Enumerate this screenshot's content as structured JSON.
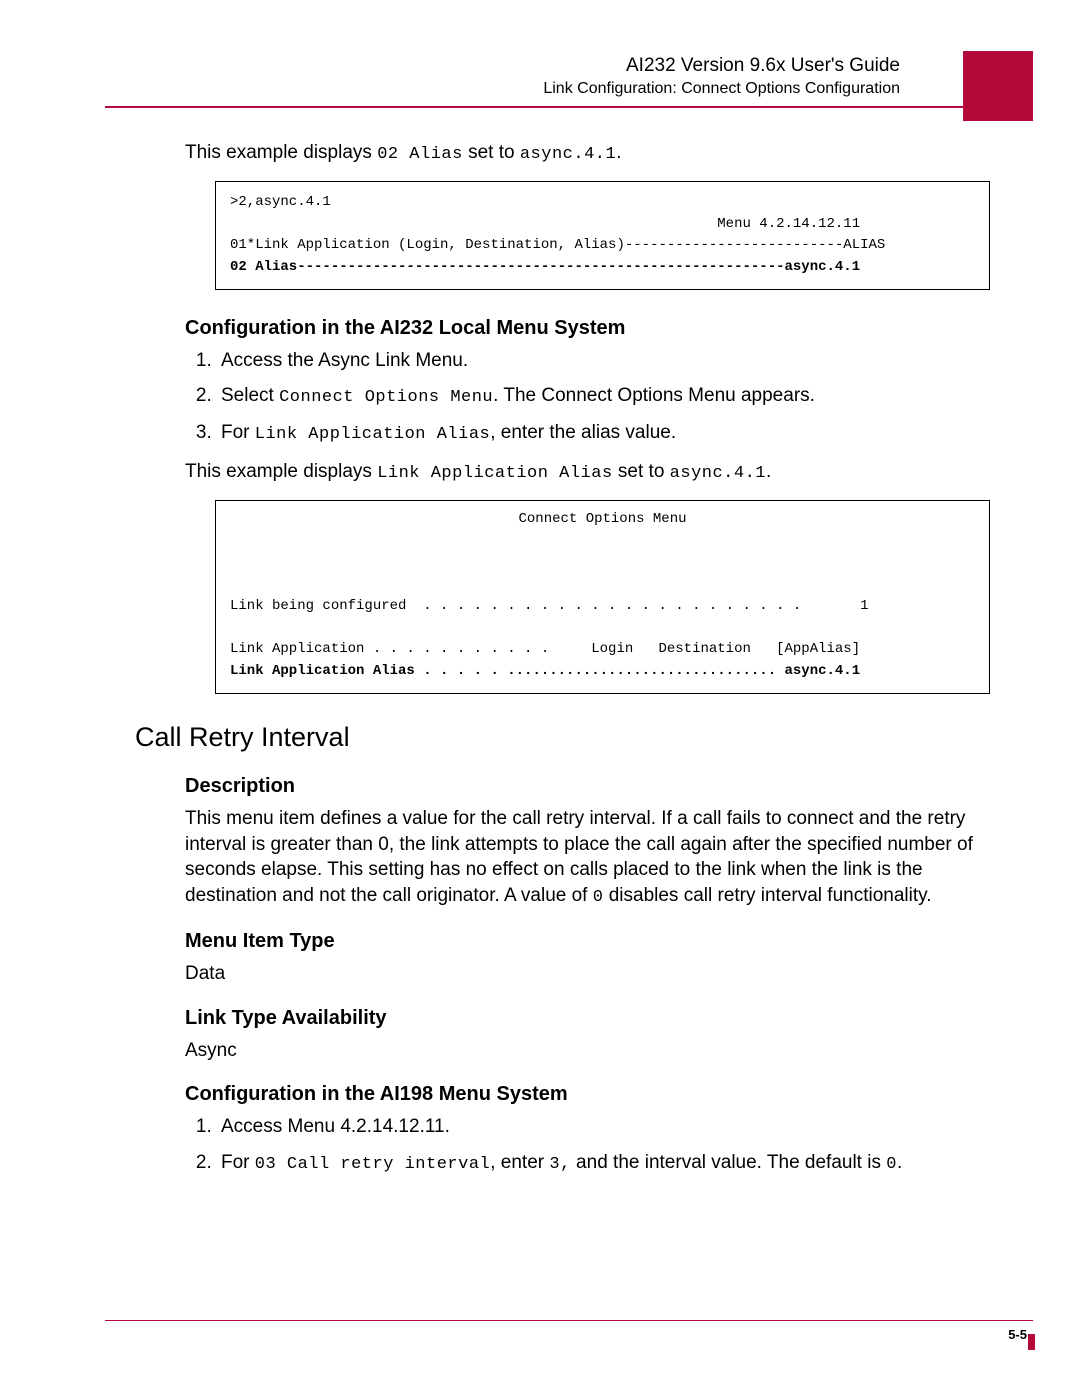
{
  "header": {
    "title": "AI232 Version 9.6x User's Guide",
    "subtitle": "Link Configuration: Connect Options Configuration"
  },
  "intro_example": {
    "prefix": "This example displays ",
    "code1": "02 Alias",
    "mid": " set to ",
    "code2": "async.4.1",
    "suffix": "."
  },
  "codebox1": {
    "l1": ">2,async.4.1",
    "l2": "                                                          Menu 4.2.14.12.11",
    "l3": "01*Link Application (Login, Destination, Alias)--------------------------ALIAS",
    "l4": "02 Alias----------------------------------------------------------async.4.1"
  },
  "section_config232": {
    "heading": "Configuration in the AI232 Local Menu System",
    "steps": {
      "s1": "Access the Async Link Menu.",
      "s2_pre": "Select ",
      "s2_code": "Connect Options Menu",
      "s2_post": ". The Connect Options Menu appears.",
      "s3_pre": "For ",
      "s3_code": "Link Application Alias",
      "s3_post": ", enter the alias value."
    },
    "example": {
      "prefix": "This example displays ",
      "code1": "Link Application Alias",
      "mid": " set to ",
      "code2": "async.4.1",
      "suffix": "."
    }
  },
  "codebox2": {
    "title": "Connect Options Menu",
    "blank": "",
    "l1": "Link being configured  . . . . . . . . . . . . . . . . . . . . . . .       1",
    "l2": "Link Application . . . . . . . . . . .     Login   Destination   [AppAlias]",
    "l3": "Link Application Alias . . . . . ................................ async.4.1"
  },
  "section_callretry": {
    "heading": "Call Retry Interval",
    "desc_heading": "Description",
    "desc_body_pre": "This menu item defines a value for the call retry interval. If a call fails to connect and the retry interval is greater than 0, the link attempts to place the call again after the specified number of seconds elapse. This setting has no effect on calls placed to the link when the link is the destination and not the call originator. A value of ",
    "desc_zero": "0",
    "desc_body_post": " disables call retry interval functionality.",
    "menu_type_heading": "Menu Item Type",
    "menu_type_value": "Data",
    "link_avail_heading": "Link Type Availability",
    "link_avail_value": "Async",
    "config198_heading": "Configuration in the AI198 Menu System",
    "steps": {
      "s1": "Access Menu 4.2.14.12.11.",
      "s2_pre": "For ",
      "s2_code": "03 Call retry interval",
      "s2_mid": ", enter ",
      "s2_code2": "3,",
      "s2_mid2": " and the interval value. The default is ",
      "s2_code3": "0",
      "s2_post": "."
    }
  },
  "footer": {
    "page": "5-5"
  }
}
